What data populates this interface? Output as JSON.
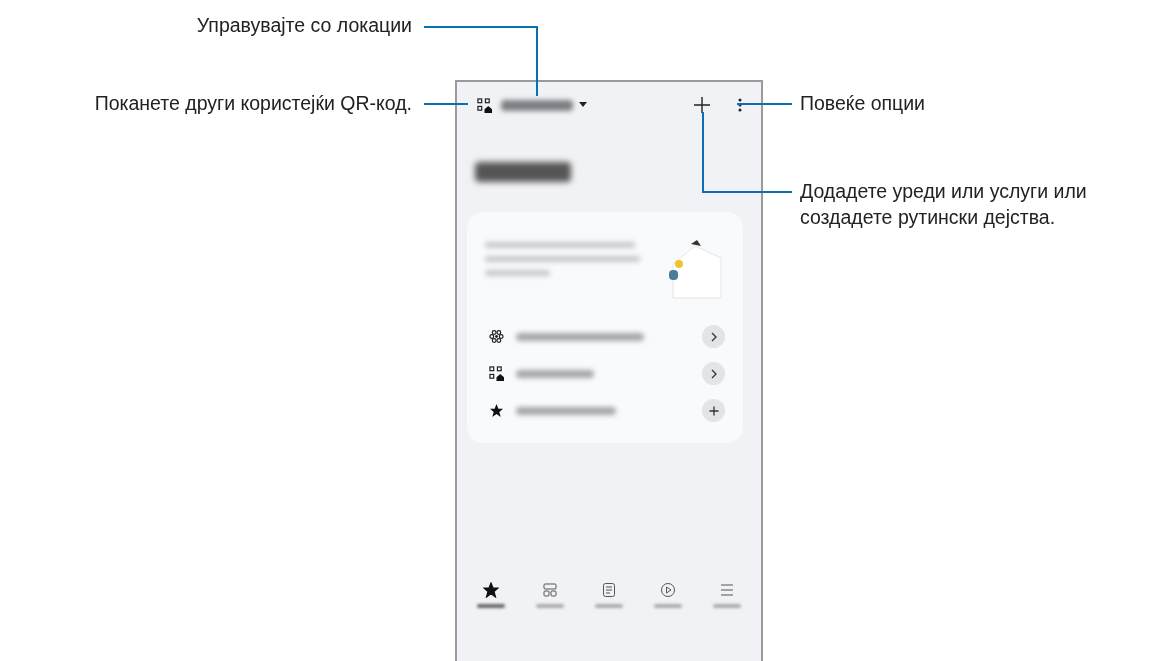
{
  "callouts": [
    {
      "text": "Управувајте со локации"
    },
    {
      "text": "Поканете други користејќи QR-код."
    },
    {
      "text": "Повеќе опции"
    },
    {
      "text": "Додадете уреди или услуги или создадете рутински дејства."
    }
  ],
  "card_rows": [
    {
      "kind": "arrow"
    },
    {
      "kind": "arrow"
    },
    {
      "kind": "add"
    }
  ],
  "nav_items": [
    {
      "selected": true
    },
    {
      "selected": false
    },
    {
      "selected": false
    },
    {
      "selected": false
    },
    {
      "selected": false
    }
  ]
}
